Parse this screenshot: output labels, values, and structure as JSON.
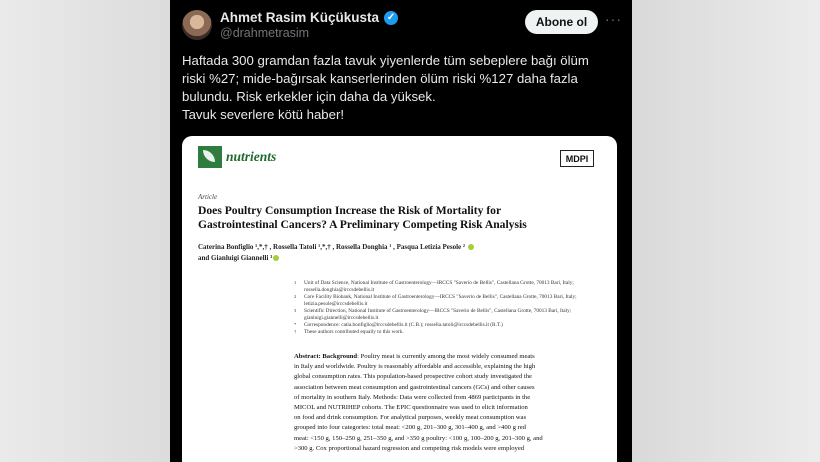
{
  "author": {
    "name": "Ahmet Rasim Küçükusta",
    "handle": "@drahmetrasim",
    "verified": true
  },
  "follow_label": "Abone ol",
  "more_label": "···",
  "tweet_lines": [
    "Haftada 300 gramdan fazla tavuk yiyenlerde tüm sebeplere bağı ölüm",
    "riski %27; mide-bağırsak kanserlerinden ölüm riski %127 daha fazla",
    "bulundu. Risk erkekler için daha da yüksek.",
    "Tavuk severlere kötü haber!"
  ],
  "paper": {
    "journal": "nutrients",
    "publisher": "MDPI",
    "kind": "Article",
    "title_lines": [
      "Does Poultry Consumption Increase the Risk of Mortality for",
      "Gastrointestinal Cancers? A Preliminary Competing Risk Analysis"
    ],
    "author_lines": [
      "Caterina Bonfiglio ¹,*,† , Rossella Tatoli ¹,*,† , Rossella Donghia ¹ , Pasqua Letizia Pesole ² ",
      "and Gianluigi Giannelli ³"
    ],
    "affiliations": [
      {
        "num": "1",
        "text": "Unit of Data Science, National Institute of Gastroenterology—IRCCS \"Saverio de Bellis\", Castellana Grotte, 70013 Bari, Italy; rossella.donghia@irccsdebellis.it"
      },
      {
        "num": "2",
        "text": "Core Facility Biobank, National Institute of Gastroenterology—IRCCS \"Saverio de Bellis\", Castellana Grotte, 70013 Bari, Italy; letizia.pesole@irccsdebellis.it"
      },
      {
        "num": "3",
        "text": "Scientific Direction, National Institute of Gastroenterology—IRCCS \"Saverio de Bellis\", Castellana Grotte, 70013 Bari, Italy; gianluigi.giannelli@irccsdebellis.it"
      },
      {
        "num": "*",
        "text": "Correspondence: catia.bonfiglio@irccsdebellis.it (C.B.); rossella.tatoli@irccsdebellis.it (R.T.)"
      },
      {
        "num": "†",
        "text": "These authors contributed equally to this work."
      }
    ],
    "abstract_label": "Abstract: Background",
    "abstract_lines": [
      ": Poultry meat is currently among the most widely consumed meats",
      "in Italy and worldwide. Poultry is reasonably affordable and accessible, explaining the high",
      "global consumption rates. This population-based prospective cohort study investigated the",
      "association between meat consumption and gastrointestinal cancers (GCs) and other causes",
      "of mortality in southern Italy. Methods: Data were collected from 4869 participants in the",
      "MICOL and NUTRIHEP cohorts. The EPIC questionnaire was used to elicit information",
      "on food and drink consumption. For analytical purposes, weekly meat consumption was",
      "grouped into four categories: total meat: <200 g, 201–300 g, 301–400 g, and >400 g red",
      "meat: <150 g, 150–250 g, 251–350 g, and >350 g poultry: <100 g, 100–200 g, 201–300 g, and",
      ">300 g. Cox proportional hazard regression and competing risk models were employed"
    ]
  }
}
